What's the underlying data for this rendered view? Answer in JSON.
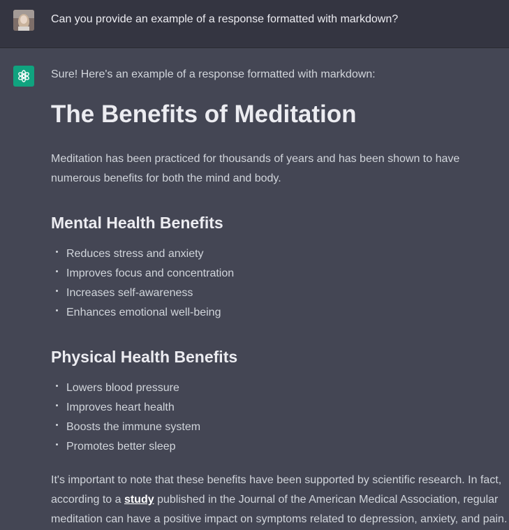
{
  "user_message": {
    "avatar": "user-avatar-photo",
    "text": "Can you provide an example of a response formatted with markdown?"
  },
  "assistant_message": {
    "icon": "openai-logo-icon",
    "intro": "Sure! Here's an example of a response formatted with markdown:",
    "title": "The Benefits of Meditation",
    "paragraph": "Meditation has been practiced for thousands of years and has been shown to have numerous benefits for both the mind and body.",
    "sections": [
      {
        "heading": "Mental Health Benefits",
        "items": [
          "Reduces stress and anxiety",
          "Improves focus and concentration",
          "Increases self-awareness",
          "Enhances emotional well-being"
        ]
      },
      {
        "heading": "Physical Health Benefits",
        "items": [
          "Lowers blood pressure",
          "Improves heart health",
          "Boosts the immune system",
          "Promotes better sleep"
        ]
      }
    ],
    "closing": {
      "before_link": "It's important to note that these benefits have been supported by scientific research. In fact, according to a ",
      "link_text": "study",
      "after_link": " published in the Journal of the American Medical Association, regular meditation can have a positive impact on symptoms related to depression, anxiety, and pain."
    }
  },
  "colors": {
    "user_bg": "#343541",
    "assistant_bg": "#444654",
    "accent": "#10a37f",
    "text": "#d1d5db"
  }
}
